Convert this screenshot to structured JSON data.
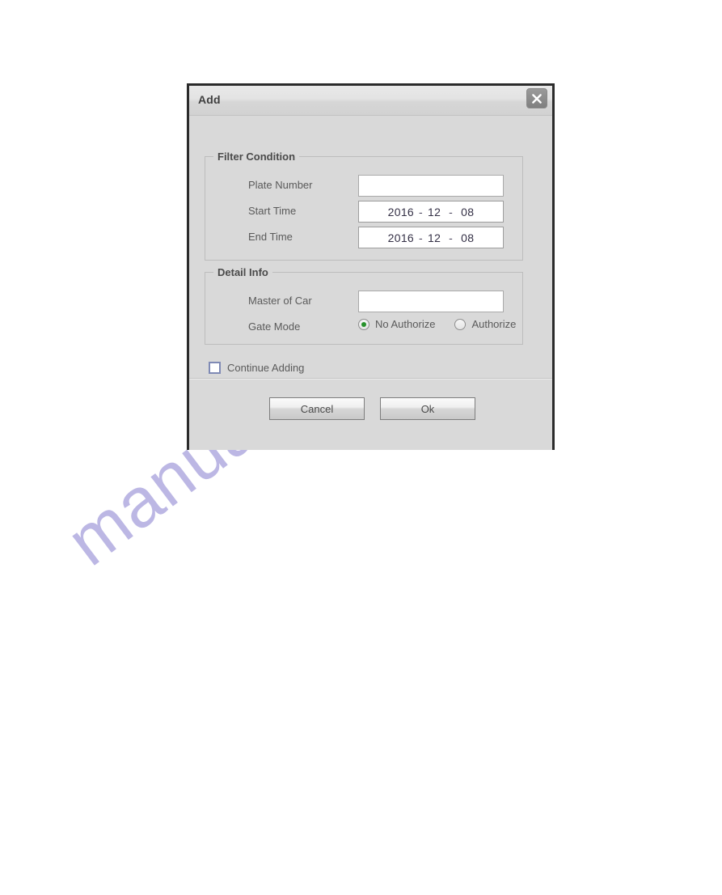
{
  "watermark": {
    "text": "manualshive.com",
    "color": "#b9b4e3"
  },
  "dialog": {
    "title": "Add",
    "close_icon": "close-icon",
    "groups": {
      "filter": {
        "legend": "Filter Condition",
        "rows": {
          "plate_number": {
            "label": "Plate Number",
            "value": "",
            "placeholder": ""
          },
          "start_time": {
            "label": "Start Time",
            "year": "2016",
            "month": "12",
            "day": "08",
            "sep": "-"
          },
          "end_time": {
            "label": "End Time",
            "year": "2016",
            "month": "12",
            "day": "08",
            "sep": "-"
          }
        }
      },
      "detail": {
        "legend": "Detail Info",
        "rows": {
          "master_of_car": {
            "label": "Master of Car",
            "value": "",
            "placeholder": ""
          },
          "gate_mode": {
            "label": "Gate Mode",
            "options": [
              {
                "label": "No Authorize",
                "selected": true
              },
              {
                "label": "Authorize",
                "selected": false
              }
            ],
            "selected_color": "#27922b"
          }
        }
      }
    },
    "continue_adding": {
      "label": "Continue Adding",
      "checked": false
    },
    "footer": {
      "cancel_label": "Cancel",
      "ok_label": "Ok"
    }
  }
}
